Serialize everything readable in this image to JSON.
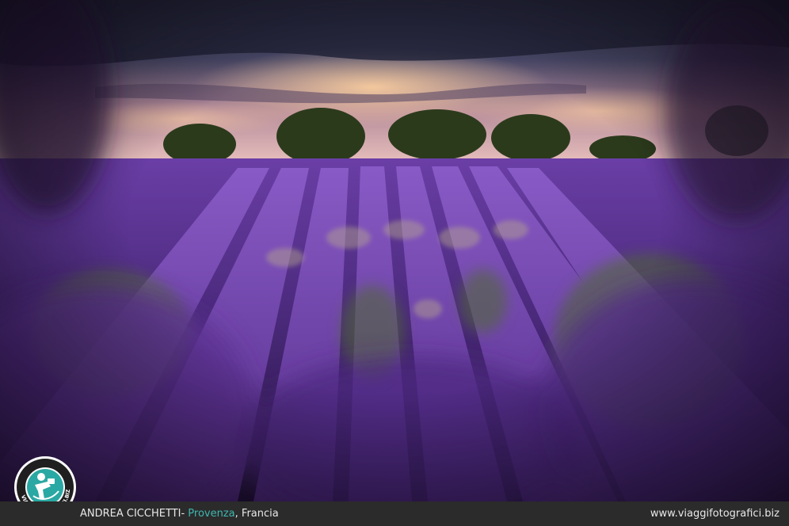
{
  "caption": {
    "author": "ANDREA CICCHETTI",
    "separator": "- ",
    "location": "Provenza",
    "country_sep": ", ",
    "country": "Francia",
    "website": "www.viaggifotografici.biz"
  },
  "logo": {
    "text": "VIAGGIFOTOGRAFICI.BIZ",
    "icon": "photographer-with-camera-icon"
  },
  "colors": {
    "accent": "#3fb6b0",
    "lavender": "#5b2f8f",
    "sky_glow": "#f4b48a",
    "caption_bar": "#2b2b2b"
  }
}
